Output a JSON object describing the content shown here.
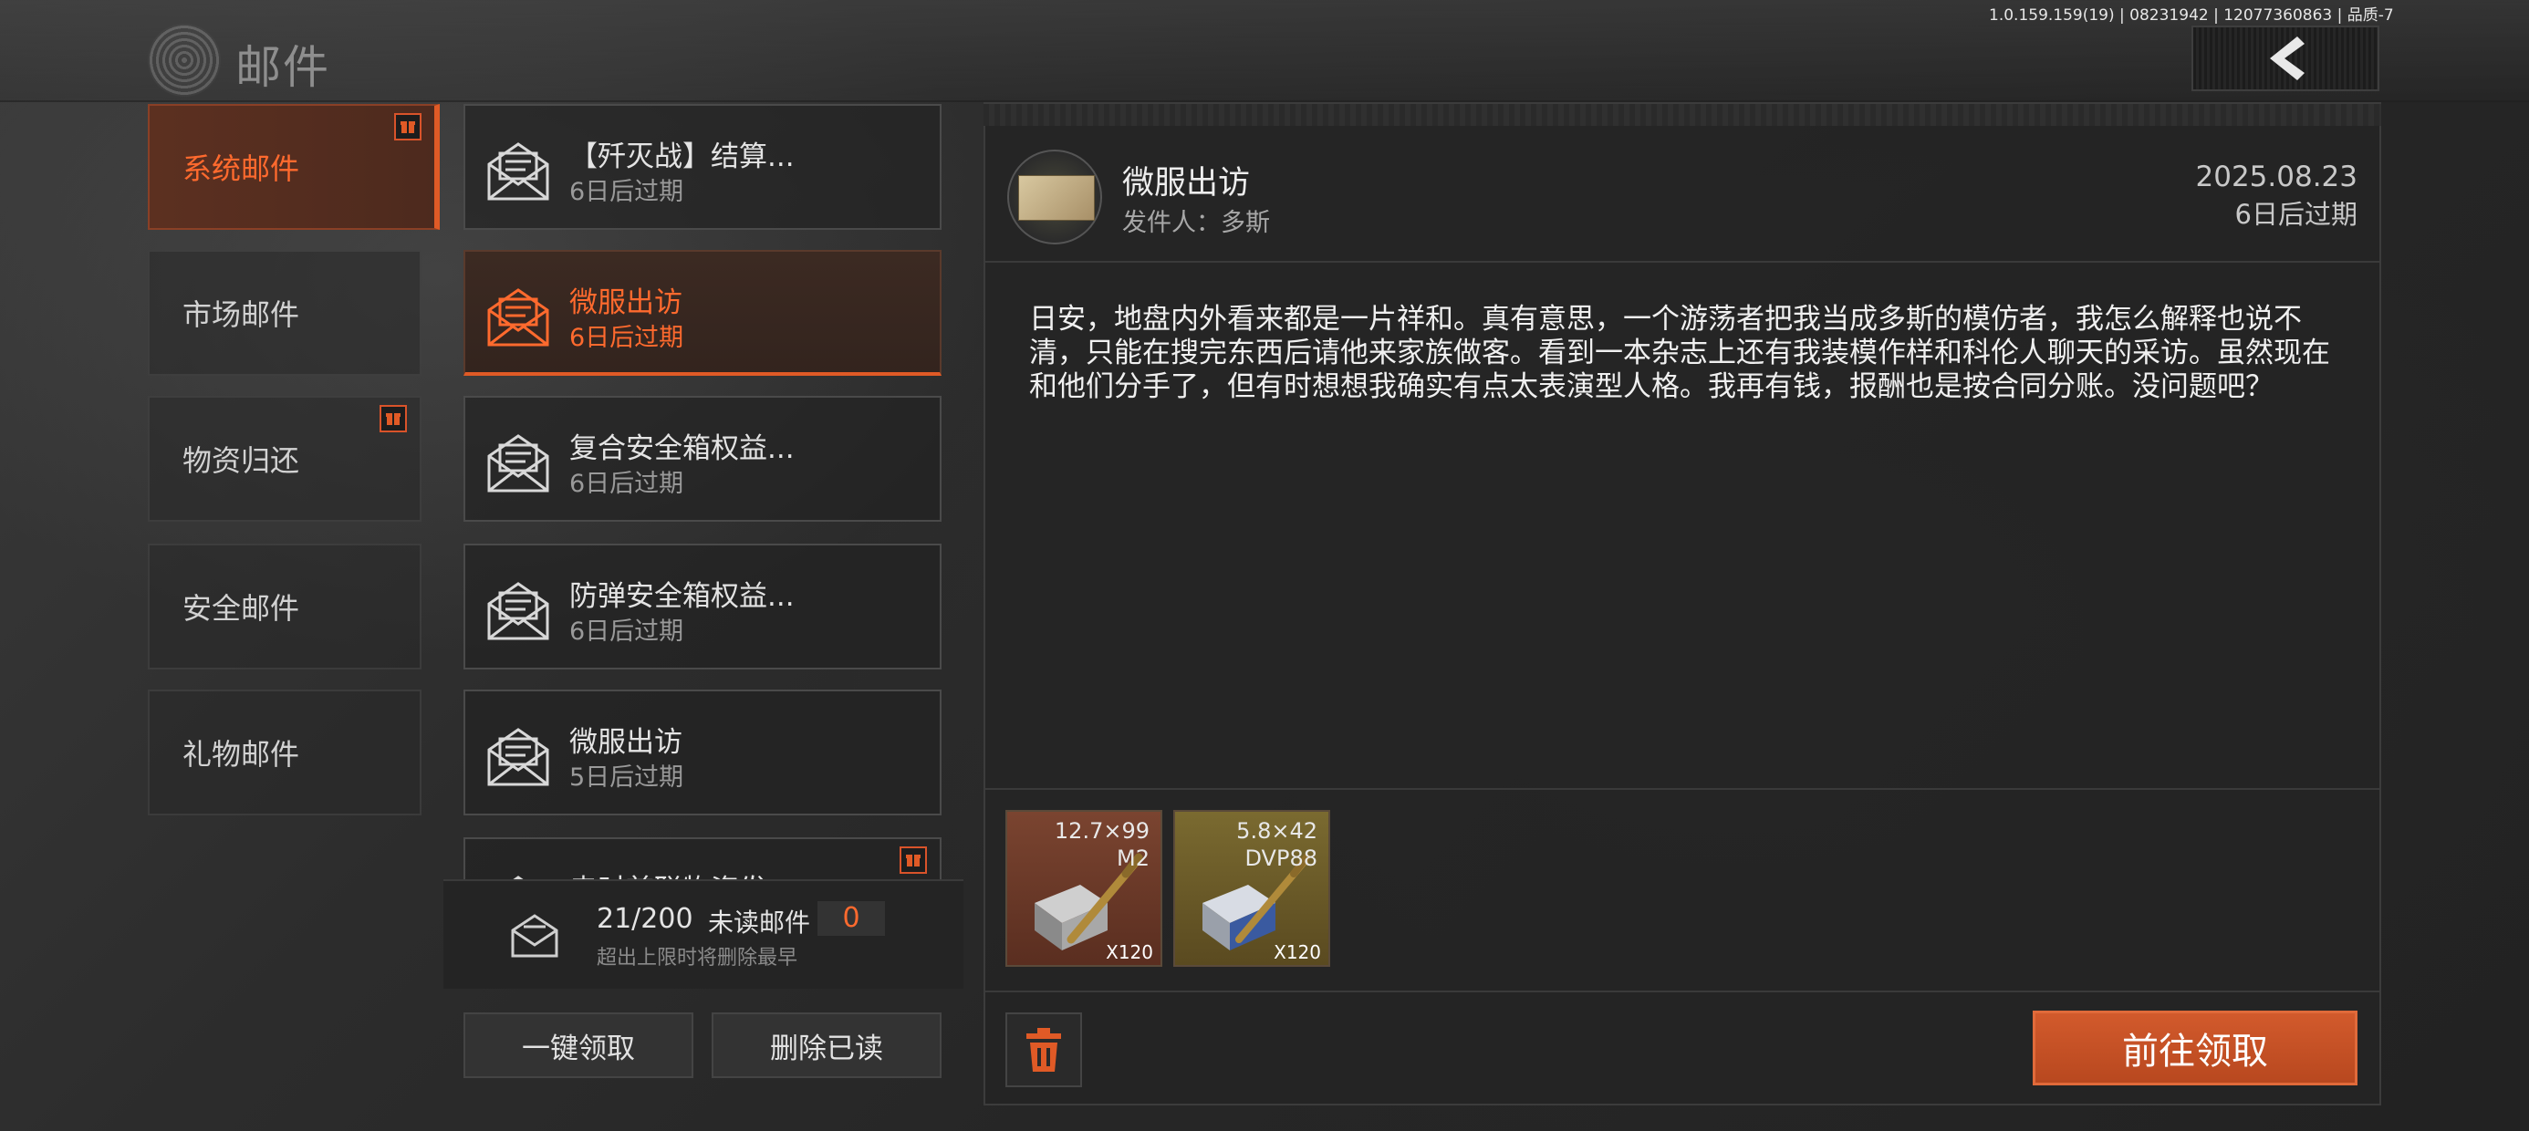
{
  "header": {
    "title": "邮件",
    "version": "1.0.159.159(19) | 08231942 | 12077360863 | 品质-7"
  },
  "categories": [
    {
      "label": "系统邮件",
      "active": true,
      "gift": true
    },
    {
      "label": "市场邮件",
      "active": false,
      "gift": false
    },
    {
      "label": "物资归还",
      "active": false,
      "gift": true
    },
    {
      "label": "安全邮件",
      "active": false,
      "gift": false
    },
    {
      "label": "礼物邮件",
      "active": false,
      "gift": false
    }
  ],
  "mails": [
    {
      "title": "【歼灭战】结算...",
      "expire": "6日后过期",
      "active": false
    },
    {
      "title": "微服出访",
      "expire": "6日后过期",
      "active": true
    },
    {
      "title": "复合安全箱权益...",
      "expire": "6日后过期",
      "active": false
    },
    {
      "title": "防弹安全箱权益...",
      "expire": "6日后过期",
      "active": false
    },
    {
      "title": "微服出访",
      "expire": "5日后过期",
      "active": false
    },
    {
      "title": "忠时首联物资发",
      "expire": "",
      "active": false
    }
  ],
  "counter": {
    "count": "21/200",
    "unread_label": "未读邮件",
    "unread_value": "0",
    "note": "超出上限时将删除最早"
  },
  "list_actions": {
    "claim_all": "一键领取",
    "delete_read": "删除已读"
  },
  "detail": {
    "title": "微服出访",
    "sender": "发件人：多斯",
    "date": "2025.08.23",
    "expire": "6日后过期",
    "body": "日安，地盘内外看来都是一片祥和。真有意思，一个游荡者把我当成多斯的模仿者，我怎么解释也说不清，只能在搜完东西后请他来家族做客。看到一本杂志上还有我装模作样和科伦人聊天的采访。虽然现在和他们分手了，但有时想想我确实有点太表演型人格。我再有钱，报酬也是按合同分账。没问题吧？",
    "attachments": [
      {
        "caliber_line1": "12.7×99",
        "caliber_line2": "M2",
        "qty": "X120",
        "bg": "#6b3a26"
      },
      {
        "caliber_line1": "5.8×42",
        "caliber_line2": "DVP88",
        "qty": "X120",
        "bg": "#6a5a2a"
      }
    ],
    "claim_button": "前往领取"
  },
  "colors": {
    "accent": "#e05a26",
    "accent_text": "#ff6a2e"
  }
}
